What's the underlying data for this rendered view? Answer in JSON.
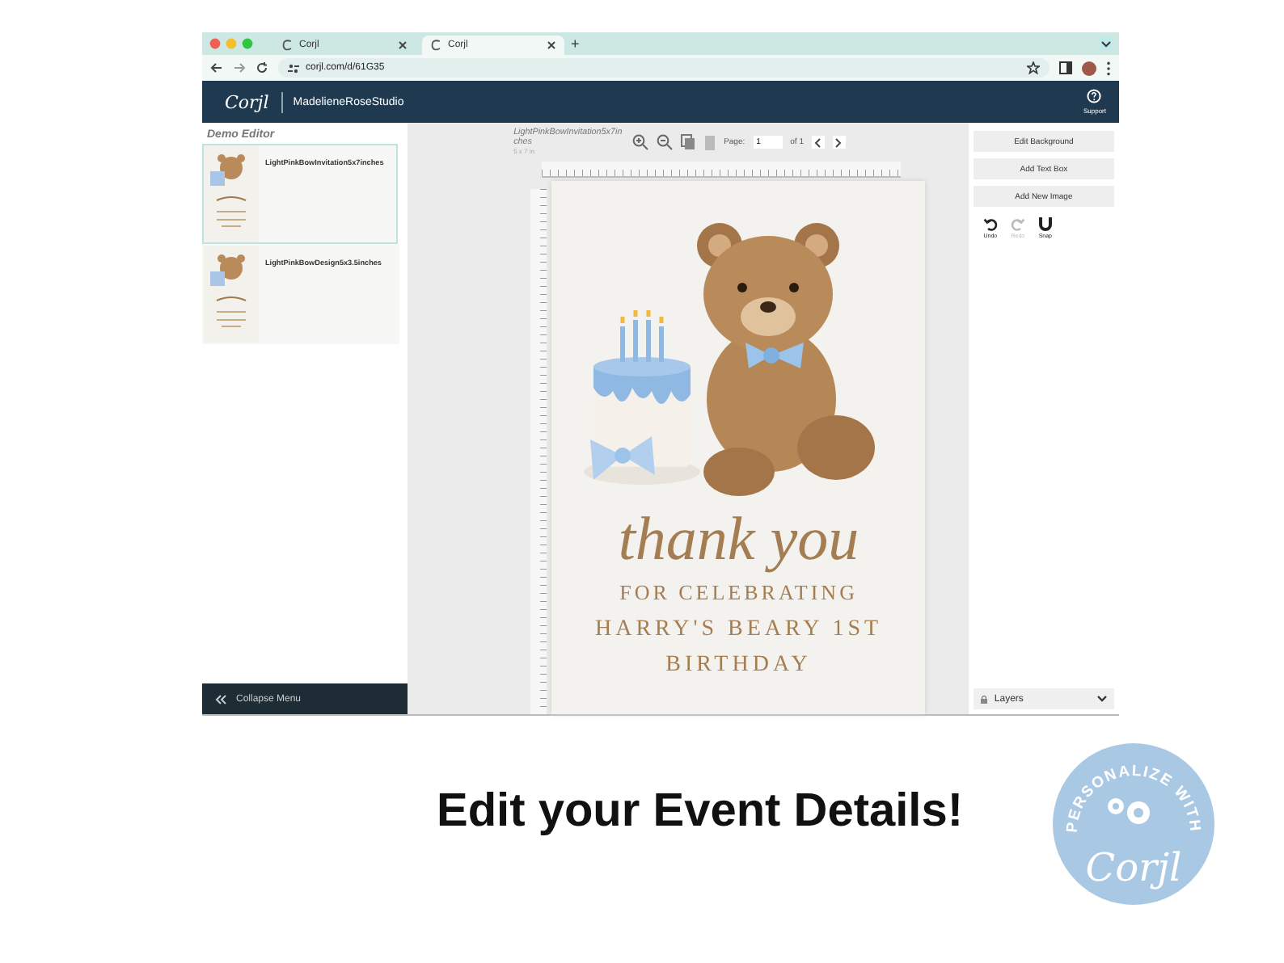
{
  "browser": {
    "tabs": [
      {
        "title": "Corjl",
        "selected": false
      },
      {
        "title": "Corjl",
        "selected": true
      }
    ],
    "new_tab": "+",
    "url": "corjl.com/d/61G35"
  },
  "header": {
    "logo": "Corjl",
    "studio": "MadelieneRoseStudio",
    "support": "Support"
  },
  "sidebar": {
    "title": "Demo Editor",
    "designs": [
      {
        "name": "LightPinkBowInvitation5x7inches",
        "selected": true
      },
      {
        "name": "LightPinkBowDesign5x3.5inches",
        "selected": false
      }
    ],
    "collapse": "Collapse Menu"
  },
  "toolbar": {
    "design_name": "LightPinkBowInvitation5x7inches",
    "size": "5 x 7 in",
    "page_label": "Page:",
    "page": "1",
    "page_total": "of 1"
  },
  "card": {
    "title": "thank you",
    "line1": "FOR CELEBRATING",
    "line2": "HARRY'S BEARY 1ST",
    "line3": "BIRTHDAY"
  },
  "right_panel": {
    "buttons": [
      "Edit Background",
      "Add Text Box",
      "Add New Image"
    ],
    "tools": [
      {
        "kind": "undo",
        "label": "Undo",
        "disabled": false
      },
      {
        "kind": "redo",
        "label": "Redo",
        "disabled": true
      },
      {
        "kind": "snap",
        "label": "Snap",
        "disabled": false
      }
    ],
    "layers": "Layers"
  },
  "caption": "Edit your Event Details!",
  "badge": {
    "arc": "PERSONALIZE WITH",
    "logo": "Corjl"
  }
}
